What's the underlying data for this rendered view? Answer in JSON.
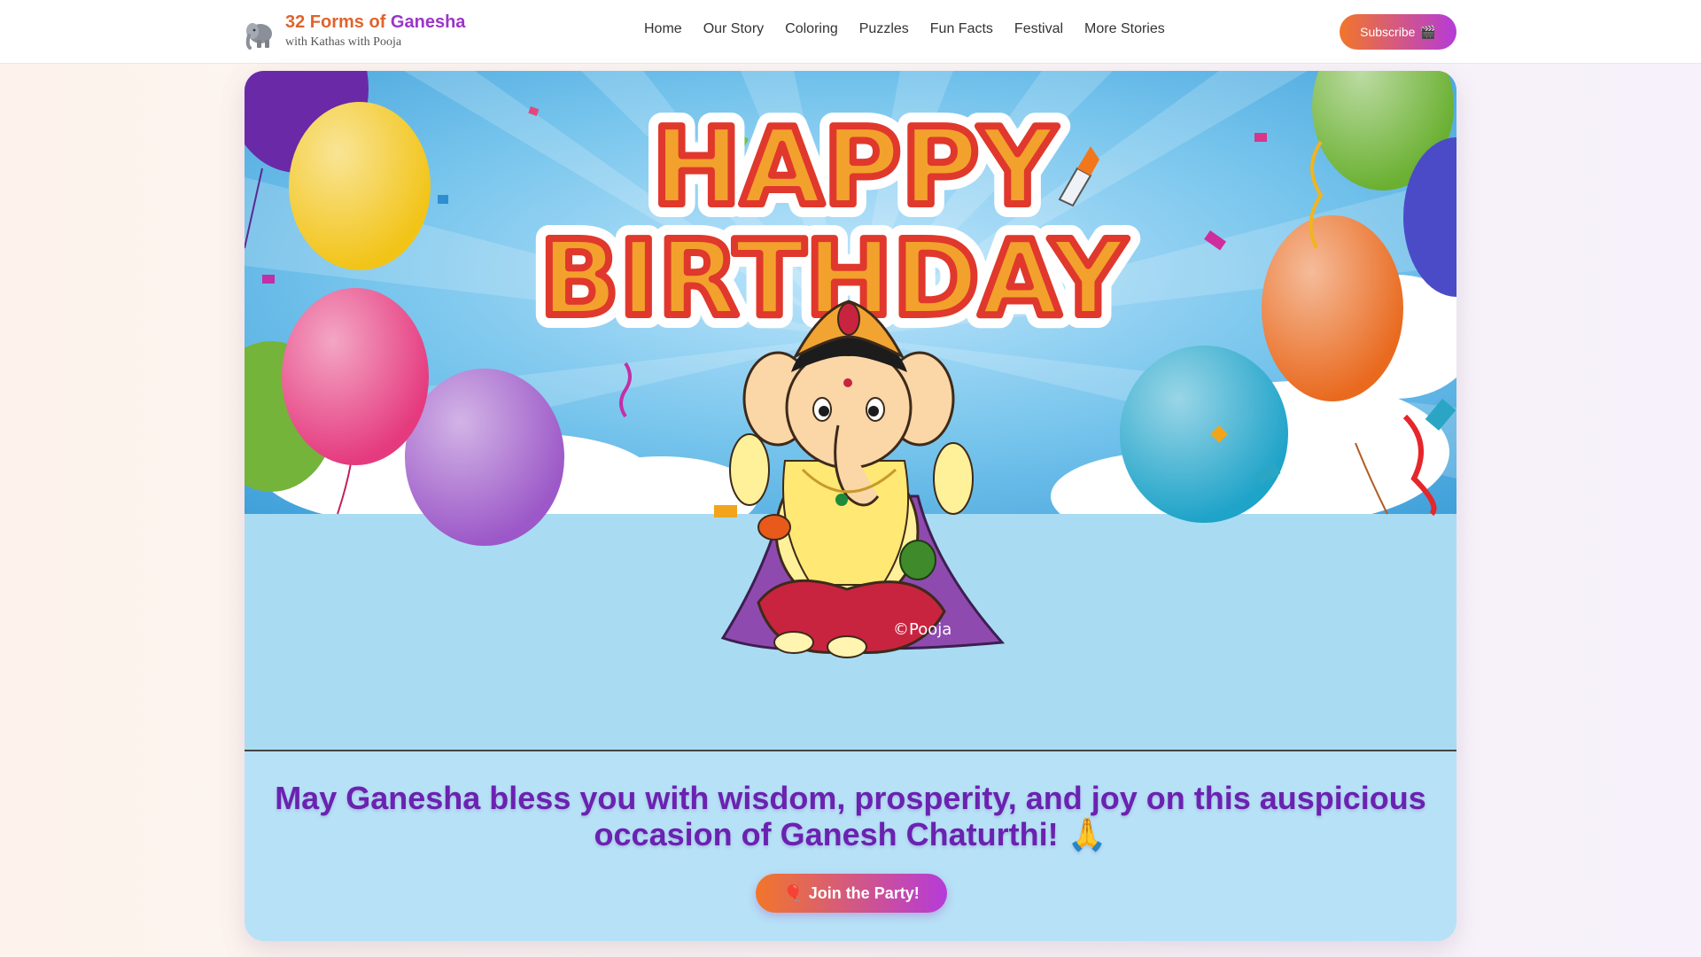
{
  "header": {
    "brand_title_main": "32 Forms of ",
    "brand_title_accent": "Ganesha",
    "brand_subtitle": "with Kathas with Pooja",
    "nav": [
      "Home",
      "Our Story",
      "Coloring",
      "Puzzles",
      "Fun Facts",
      "Festival",
      "More Stories"
    ],
    "subscribe_label": "Subscribe",
    "subscribe_emoji": "🎬"
  },
  "hero": {
    "headline_line1": "HAPPY",
    "headline_line2": "BIRTHDAY",
    "watermark": "©Pooja"
  },
  "main": {
    "message": "May Ganesha bless you with wisdom, prosperity, and joy on this auspicious occasion of Ganesh Chaturthi! 🙏",
    "party_button_emoji": "🎈",
    "party_button_label": "Join the Party!"
  },
  "colors": {
    "brand_orange": "#e0632c",
    "brand_purple": "#9b35c9",
    "message_purple": "#6a22b0",
    "sky_blue": "#5ab4e6",
    "lower_panel": "#a9dcf3"
  }
}
